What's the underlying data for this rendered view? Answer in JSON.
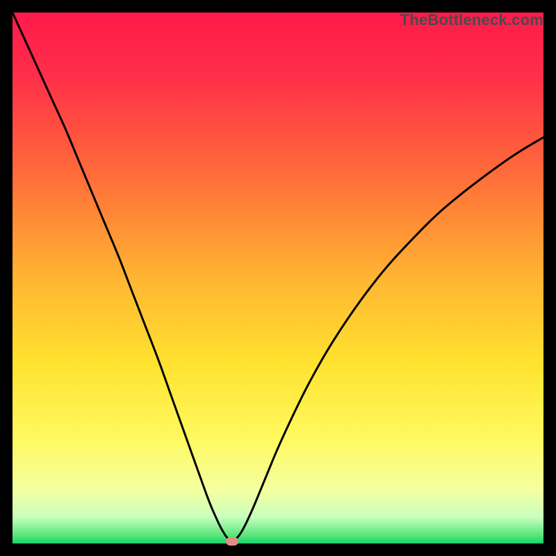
{
  "watermark": "TheBottleneck.com",
  "marker": {
    "color": "#e38d87",
    "x_frac": 0.414,
    "y_frac": 0.996
  },
  "chart_data": {
    "type": "line",
    "title": "",
    "xlabel": "",
    "ylabel": "",
    "xlim": [
      0,
      1
    ],
    "ylim": [
      0,
      1
    ],
    "grid": false,
    "legend": false,
    "gradient_stops": [
      {
        "pos": 0.0,
        "color": "#ff1a4b"
      },
      {
        "pos": 0.12,
        "color": "#ff2f49"
      },
      {
        "pos": 0.3,
        "color": "#ff6a3a"
      },
      {
        "pos": 0.5,
        "color": "#ffb531"
      },
      {
        "pos": 0.66,
        "color": "#ffe22f"
      },
      {
        "pos": 0.8,
        "color": "#fff95e"
      },
      {
        "pos": 0.9,
        "color": "#f4ffa0"
      },
      {
        "pos": 0.95,
        "color": "#c9ffbe"
      },
      {
        "pos": 0.985,
        "color": "#58e67a"
      },
      {
        "pos": 1.0,
        "color": "#17d36a"
      }
    ],
    "series": [
      {
        "name": "bottleneck-curve",
        "color": "#000000",
        "width": 3,
        "x": [
          0.0,
          0.025,
          0.05,
          0.075,
          0.1,
          0.125,
          0.15,
          0.175,
          0.2,
          0.225,
          0.25,
          0.275,
          0.3,
          0.325,
          0.35,
          0.37,
          0.385,
          0.395,
          0.405,
          0.414,
          0.43,
          0.45,
          0.475,
          0.5,
          0.53,
          0.56,
          0.6,
          0.65,
          0.7,
          0.75,
          0.8,
          0.85,
          0.9,
          0.95,
          1.0
        ],
        "y": [
          1.0,
          0.945,
          0.89,
          0.835,
          0.78,
          0.72,
          0.66,
          0.6,
          0.54,
          0.475,
          0.41,
          0.345,
          0.275,
          0.205,
          0.135,
          0.08,
          0.045,
          0.025,
          0.01,
          0.004,
          0.02,
          0.06,
          0.12,
          0.18,
          0.245,
          0.305,
          0.375,
          0.45,
          0.515,
          0.57,
          0.62,
          0.662,
          0.7,
          0.735,
          0.765
        ]
      }
    ],
    "annotations": [
      {
        "kind": "marker",
        "shape": "pill",
        "x": 0.414,
        "y": 0.004,
        "color": "#e38d87"
      }
    ]
  }
}
